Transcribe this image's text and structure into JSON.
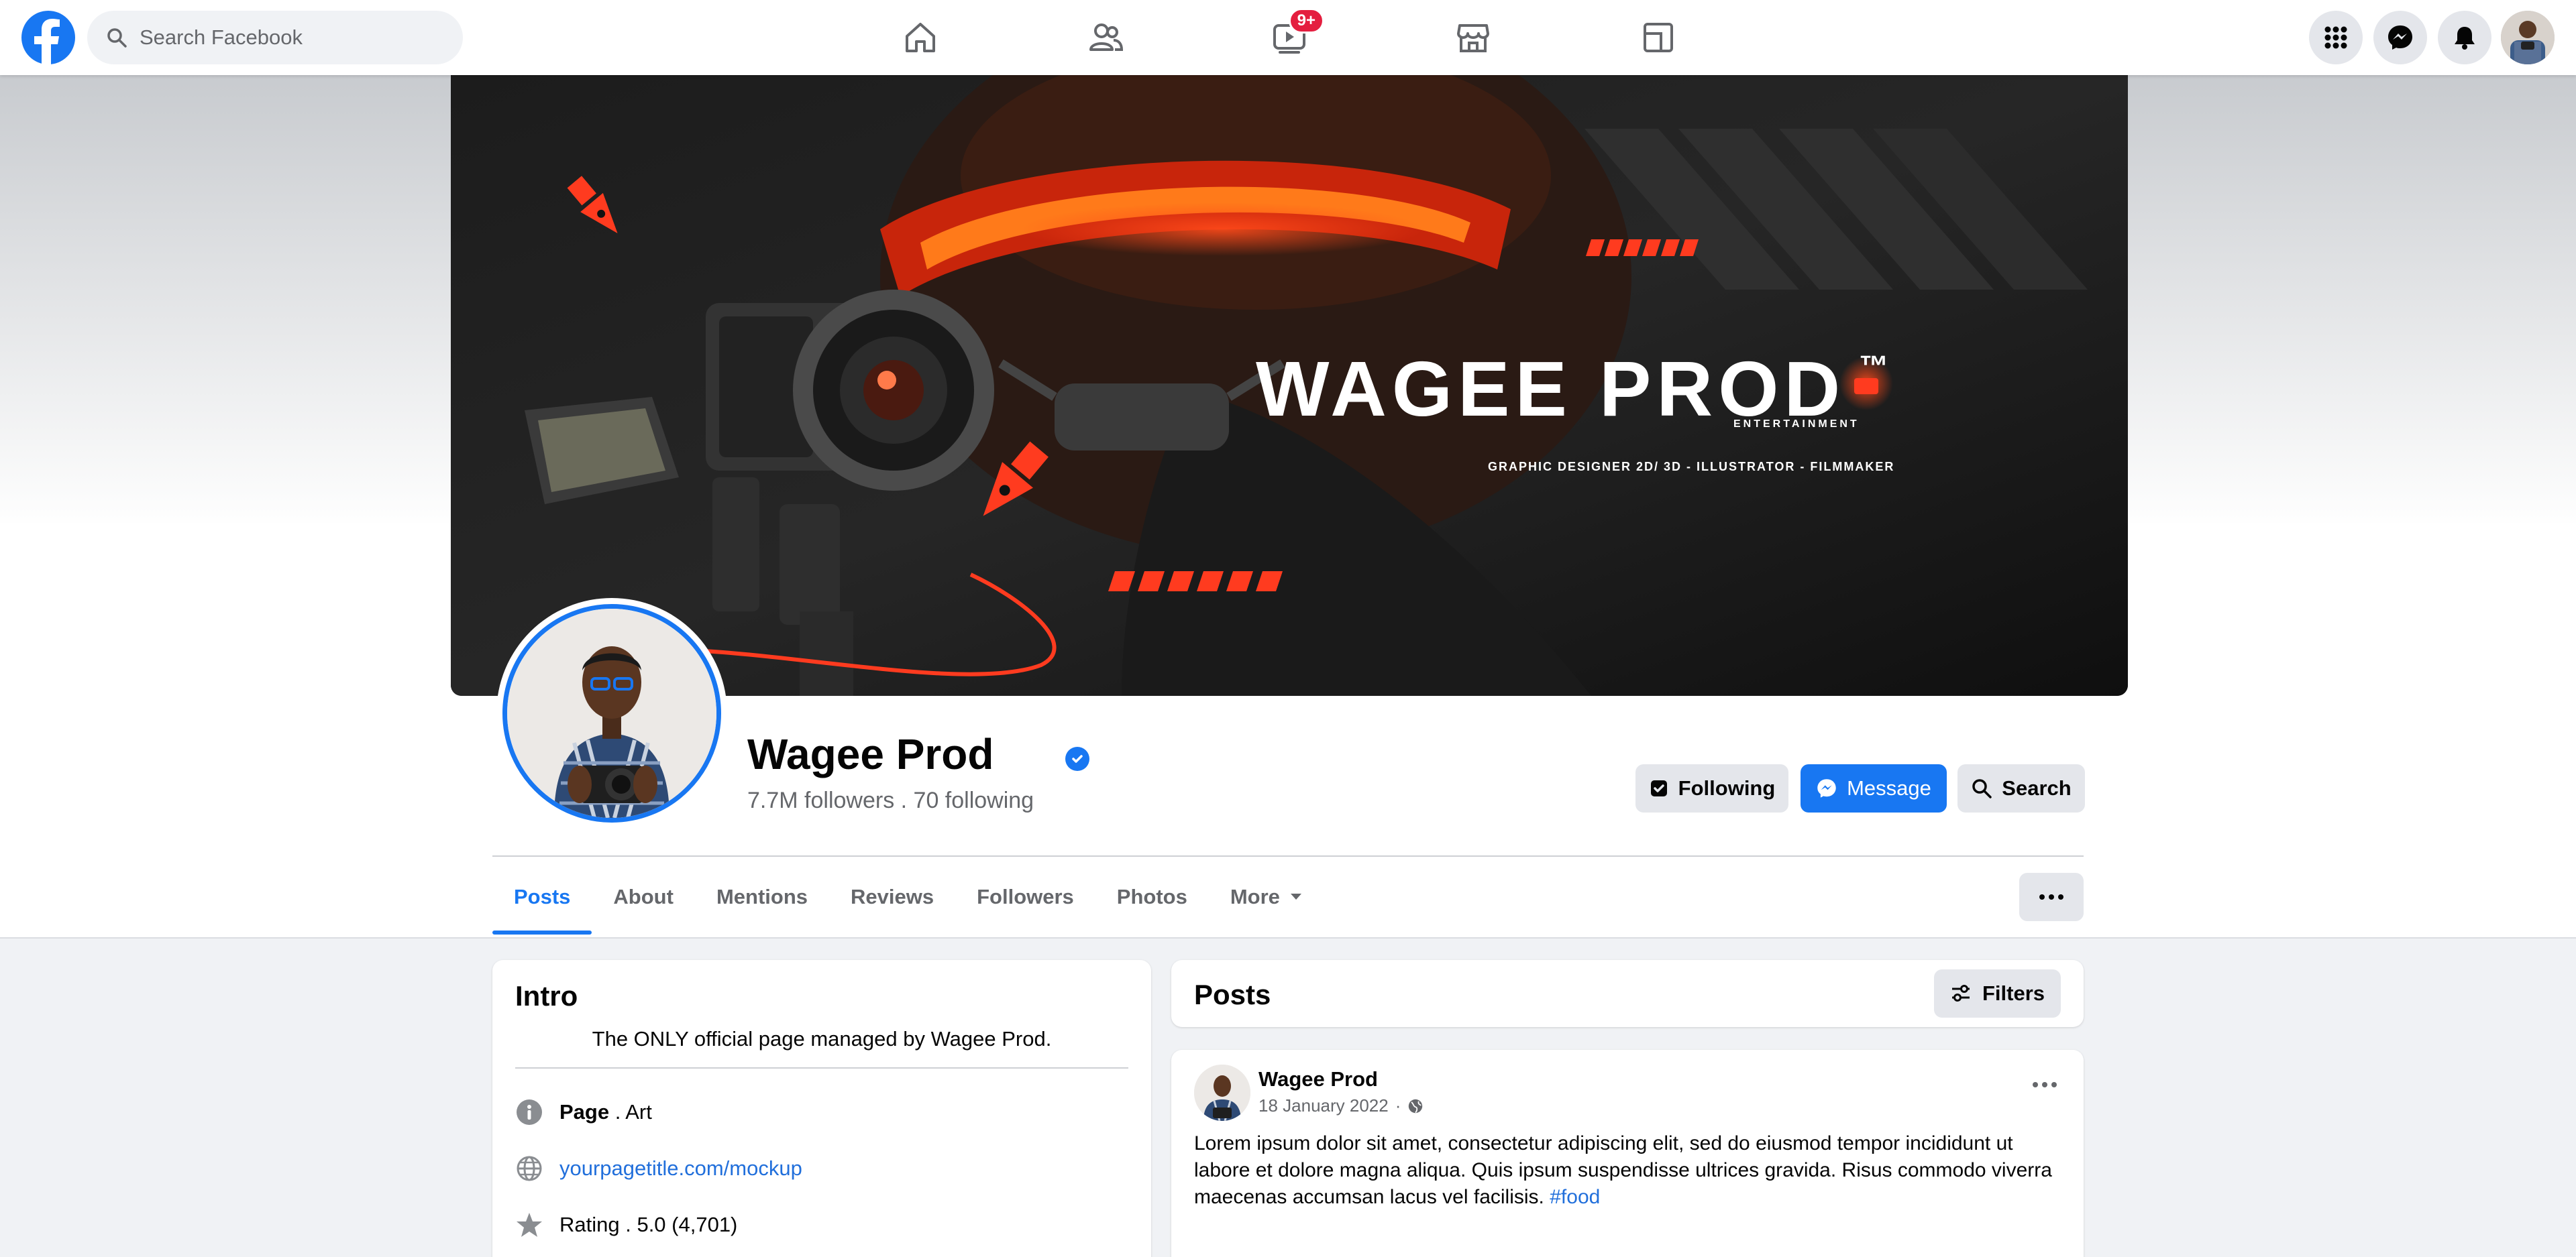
{
  "topnav": {
    "search_placeholder": "Search Facebook",
    "watch_badge": "9+",
    "nav_items": [
      "home-icon",
      "friends-icon",
      "watch-icon",
      "marketplace-icon",
      "gaming-icon"
    ]
  },
  "cover": {
    "brand_name": "WAGEE PROD",
    "trademark": "™",
    "brand_sub": "ENTERTAINMENT",
    "tagline": "GRAPHIC DESIGNER 2D/ 3D - ILLUSTRATOR - FILMMAKER"
  },
  "profile": {
    "name": "Wagee Prod",
    "followers_line": "7.7M followers . 70 following",
    "following_label": "Following",
    "message_label": "Message",
    "search_label": "Search"
  },
  "tabs": [
    {
      "label": "Posts",
      "active": true
    },
    {
      "label": "About",
      "active": false
    },
    {
      "label": "Mentions",
      "active": false
    },
    {
      "label": "Reviews",
      "active": false
    },
    {
      "label": "Followers",
      "active": false
    },
    {
      "label": "Photos",
      "active": false
    },
    {
      "label": "More",
      "active": false
    }
  ],
  "intro": {
    "title": "Intro",
    "bio": "The ONLY official page managed by Wagee Prod.",
    "page_label": "Page",
    "page_category": " . Art",
    "website": "yourpagetitle.com/mockup",
    "rating": "Rating . 5.0 (4,701)"
  },
  "posts": {
    "title": "Posts",
    "filters_label": "Filters",
    "post": {
      "author": "Wagee Prod",
      "date": "18 January 2022",
      "dot": "·",
      "text": "Lorem ipsum dolor sit amet, consectetur adipiscing elit, sed do eiusmod tempor incididunt ut labore et dolore magna aliqua. Quis ipsum suspendisse ultrices gravida. Risus commodo viverra maecenas accumsan lacus vel facilisis.",
      "hashtag": "#food"
    }
  },
  "colors": {
    "brand_blue": "#1877f2",
    "cover_accent": "#ff3b1f",
    "badge_red": "#e41e3f"
  }
}
